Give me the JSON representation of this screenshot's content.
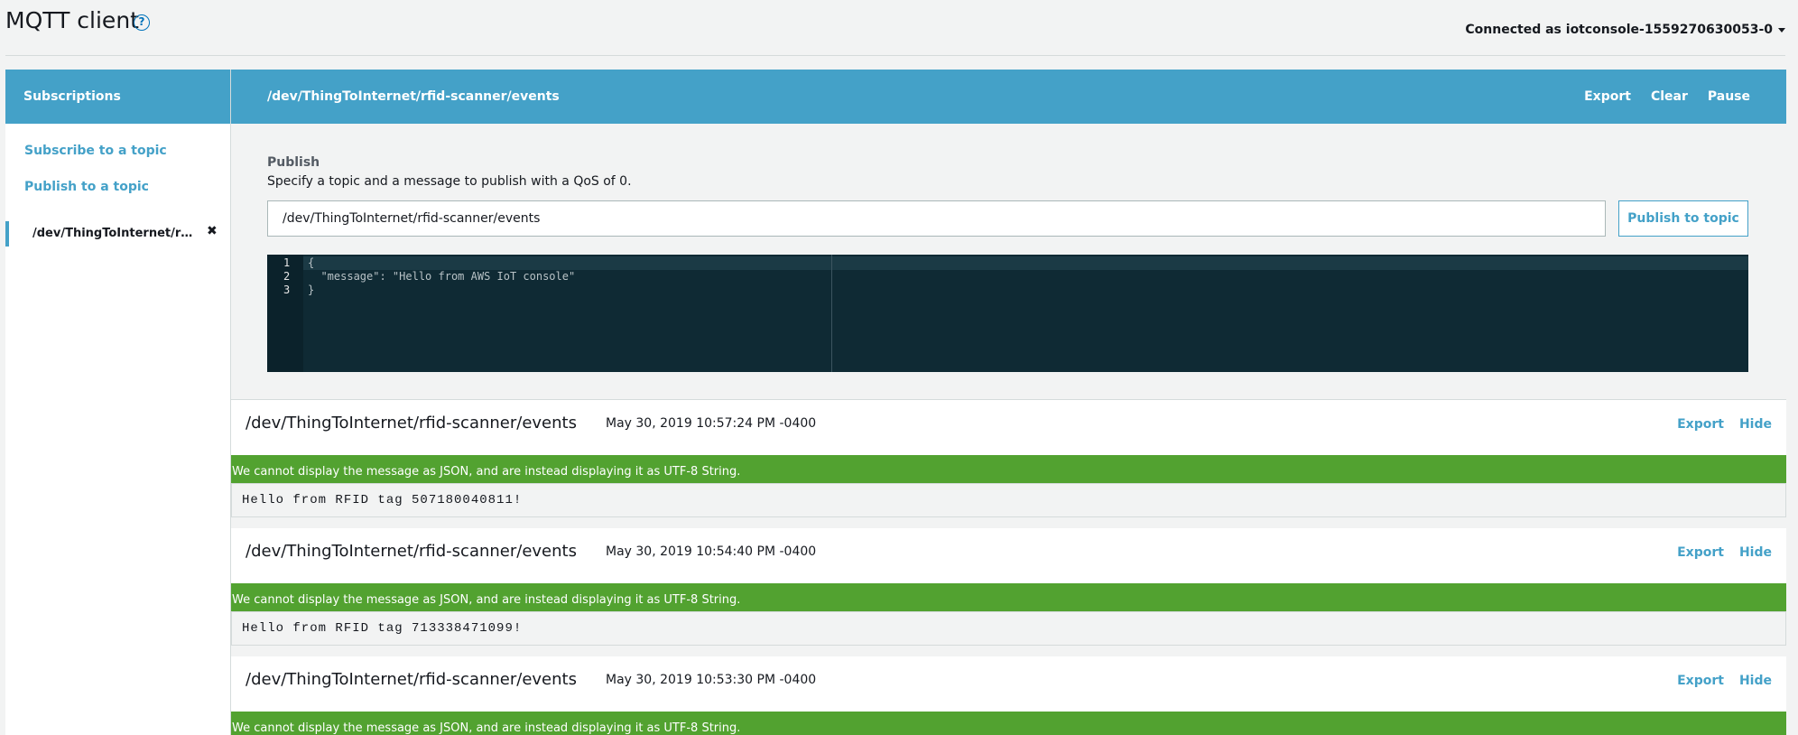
{
  "header": {
    "title": "MQTT client",
    "help_icon": "?",
    "connection": "Connected as iotconsole-1559270630053-0"
  },
  "sidebar": {
    "heading": "Subscriptions",
    "links": [
      "Subscribe to a topic",
      "Publish to a topic"
    ],
    "subscription": "/dev/ThingToInternet/rfid-scanner/events",
    "close_icon": "✖"
  },
  "topic_bar": {
    "title": "/dev/ThingToInternet/rfid-scanner/events",
    "actions": [
      "Export",
      "Clear",
      "Pause"
    ]
  },
  "publish": {
    "label": "Publish",
    "description": "Specify a topic and a message to publish with a QoS of 0.",
    "topic_value": "/dev/ThingToInternet/rfid-scanner/events",
    "button": "Publish to topic",
    "editor": {
      "line_numbers": [
        "1",
        "2",
        "3"
      ],
      "lines": [
        "{",
        "  \"message\": \"Hello from AWS IoT console\"",
        "}"
      ]
    }
  },
  "messages": [
    {
      "topic": "/dev/ThingToInternet/rfid-scanner/events",
      "time": "May 30, 2019 10:57:24 PM -0400",
      "export": "Export",
      "hide": "Hide",
      "banner": "We cannot display the message as JSON, and are instead displaying it as UTF-8 String.",
      "body": "Hello from RFID tag 507180040811!"
    },
    {
      "topic": "/dev/ThingToInternet/rfid-scanner/events",
      "time": "May 30, 2019 10:54:40 PM -0400",
      "export": "Export",
      "hide": "Hide",
      "banner": "We cannot display the message as JSON, and are instead displaying it as UTF-8 String.",
      "body": "Hello from RFID tag 713338471099!"
    },
    {
      "topic": "/dev/ThingToInternet/rfid-scanner/events",
      "time": "May 30, 2019 10:53:30 PM -0400",
      "export": "Export",
      "hide": "Hide",
      "banner": "We cannot display the message as JSON, and are instead displaying it as UTF-8 String."
    }
  ]
}
